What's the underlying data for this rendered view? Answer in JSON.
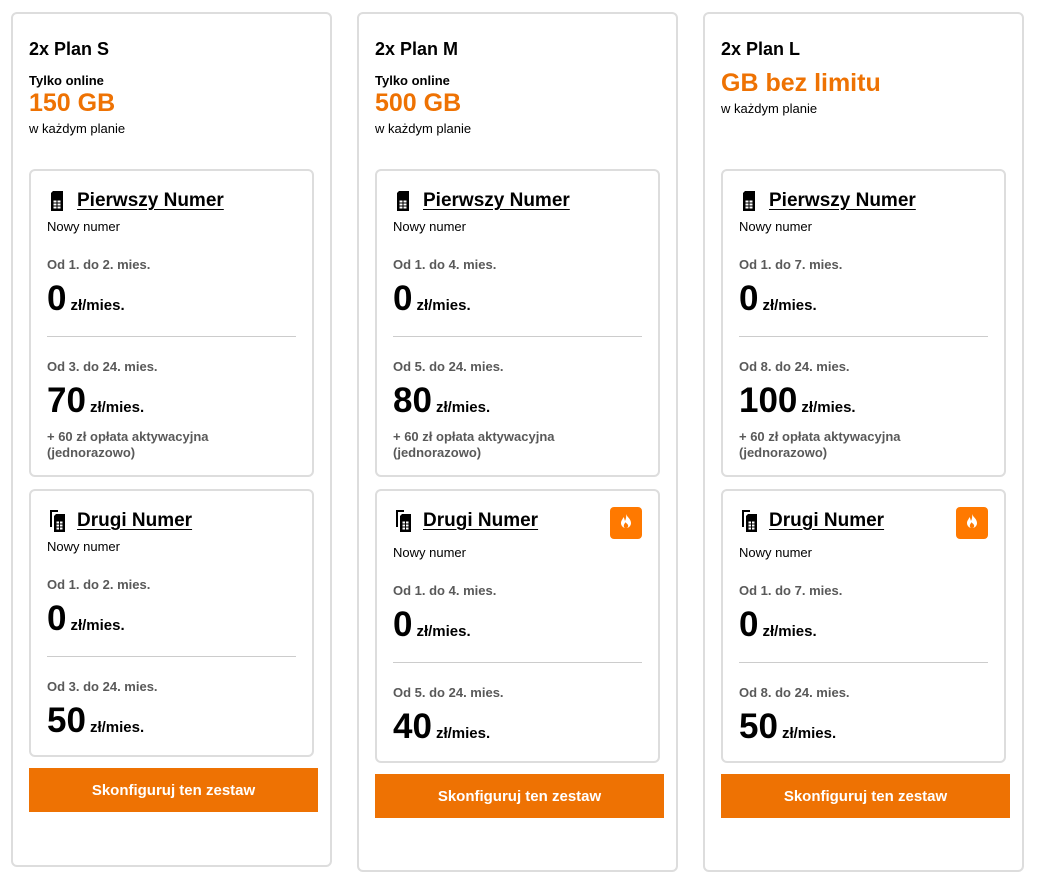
{
  "plans": [
    {
      "title": "2x Plan S",
      "online_tag": "Tylko online",
      "gb": "150 GB",
      "gb_sub": "w każdym planie",
      "first": {
        "label": "Pierwszy Numer",
        "sub": "Nowy numer",
        "p1_period": "Od 1. do 2. mies.",
        "p1_price": "0",
        "p1_unit": "zł/mies.",
        "p2_period": "Od 3. do 24. mies.",
        "p2_price": "70",
        "p2_unit": "zł/mies.",
        "note": "+ 60 zł opłata aktywacyjna (jednorazowo)"
      },
      "second": {
        "label": "Drugi Numer",
        "sub": "Nowy numer",
        "p1_period": "Od 1. do 2. mies.",
        "p1_price": "0",
        "p1_unit": "zł/mies.",
        "p2_period": "Od 3. do 24. mies.",
        "p2_price": "50",
        "p2_unit": "zł/mies."
      },
      "button": "Skonfiguruj ten zestaw"
    },
    {
      "title": "2x Plan M",
      "online_tag": "Tylko online",
      "gb": "500 GB",
      "gb_sub": "w każdym planie",
      "first": {
        "label": "Pierwszy Numer",
        "sub": "Nowy numer",
        "p1_period": "Od 1. do 4. mies.",
        "p1_price": "0",
        "p1_unit": "zł/mies.",
        "p2_period": "Od 5. do 24. mies.",
        "p2_price": "80",
        "p2_unit": "zł/mies.",
        "note": "+ 60 zł opłata aktywacyjna (jednorazowo)"
      },
      "second": {
        "label": "Drugi Numer",
        "sub": "Nowy numer",
        "p1_period": "Od 1. do 4. mies.",
        "p1_price": "0",
        "p1_unit": "zł/mies.",
        "p2_period": "Od 5. do 24. mies.",
        "p2_price": "40",
        "p2_unit": "zł/mies."
      },
      "button": "Skonfiguruj ten zestaw"
    },
    {
      "title": "2x Plan L",
      "gb": "GB bez limitu",
      "gb_sub": "w każdym planie",
      "first": {
        "label": "Pierwszy Numer",
        "sub": "Nowy numer",
        "p1_period": "Od 1. do 7. mies.",
        "p1_price": "0",
        "p1_unit": "zł/mies.",
        "p2_period": "Od 8. do 24. mies.",
        "p2_price": "100",
        "p2_unit": "zł/mies.",
        "note": "+ 60 zł opłata aktywacyjna (jednorazowo)"
      },
      "second": {
        "label": "Drugi Numer",
        "sub": "Nowy numer",
        "p1_period": "Od 1. do 7. mies.",
        "p1_price": "0",
        "p1_unit": "zł/mies.",
        "p2_period": "Od 8. do 24. mies.",
        "p2_price": "50",
        "p2_unit": "zł/mies."
      },
      "button": "Skonfiguruj ten zestaw"
    }
  ],
  "colors": {
    "accent": "#ee7203",
    "badge": "#ff7900",
    "border": "#dddddd",
    "muted": "#595959"
  },
  "icons": {
    "sim": "sim-card-icon",
    "dual_sim": "dual-sim-card-icon",
    "hot": "flame-icon"
  }
}
